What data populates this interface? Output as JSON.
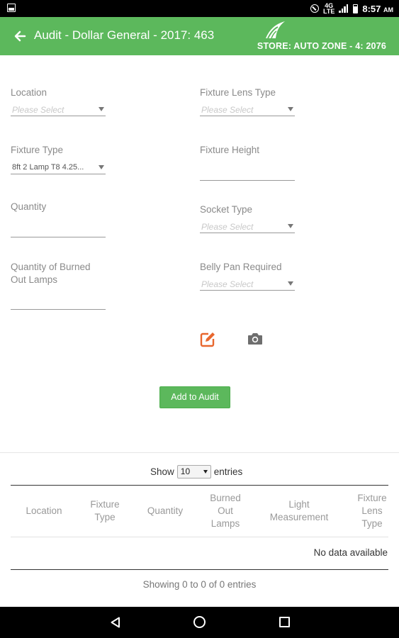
{
  "status_bar": {
    "network": "4G",
    "network_sub": "LTE",
    "time": "8:57",
    "ampm": "AM"
  },
  "app_bar": {
    "title": "Audit - Dollar General - 2017: 463",
    "store": "STORE: AUTO ZONE - 4: 2076",
    "bg_color": "#5cb85c"
  },
  "form": {
    "location": {
      "label": "Location",
      "placeholder": "Please Select"
    },
    "fixture_lens_type": {
      "label": "Fixture Lens Type",
      "placeholder": "Please Select"
    },
    "fixture_type": {
      "label": "Fixture Type",
      "value": "8ft 2 Lamp T8 4.25..."
    },
    "fixture_height": {
      "label": "Fixture Height",
      "value": ""
    },
    "quantity": {
      "label": "Quantity",
      "value": ""
    },
    "socket_type": {
      "label": "Socket Type",
      "placeholder": "Please Select"
    },
    "burned_out": {
      "label_line1": "Quantity of Burned",
      "label_line2": "Out Lamps",
      "value": ""
    },
    "belly_pan": {
      "label": "Belly Pan Required",
      "placeholder": "Please Select"
    },
    "edit_icon_color": "#e8672e",
    "add_button": "Add to Audit"
  },
  "table": {
    "show_label": "Show",
    "page_size": "10",
    "entries_label": "entries",
    "columns": [
      {
        "line1": "Location"
      },
      {
        "line1": "Fixture",
        "line2": "Type"
      },
      {
        "line1": "Quantity"
      },
      {
        "line1": "Burned",
        "line2": "Out",
        "line3": "Lamps"
      },
      {
        "line1": "Light",
        "line2": "Measurement"
      },
      {
        "line1": "Fixture",
        "line2": "Lens",
        "line3": "Type"
      }
    ],
    "empty_message": "No data available",
    "info": "Showing 0 to 0 of 0 entries"
  }
}
